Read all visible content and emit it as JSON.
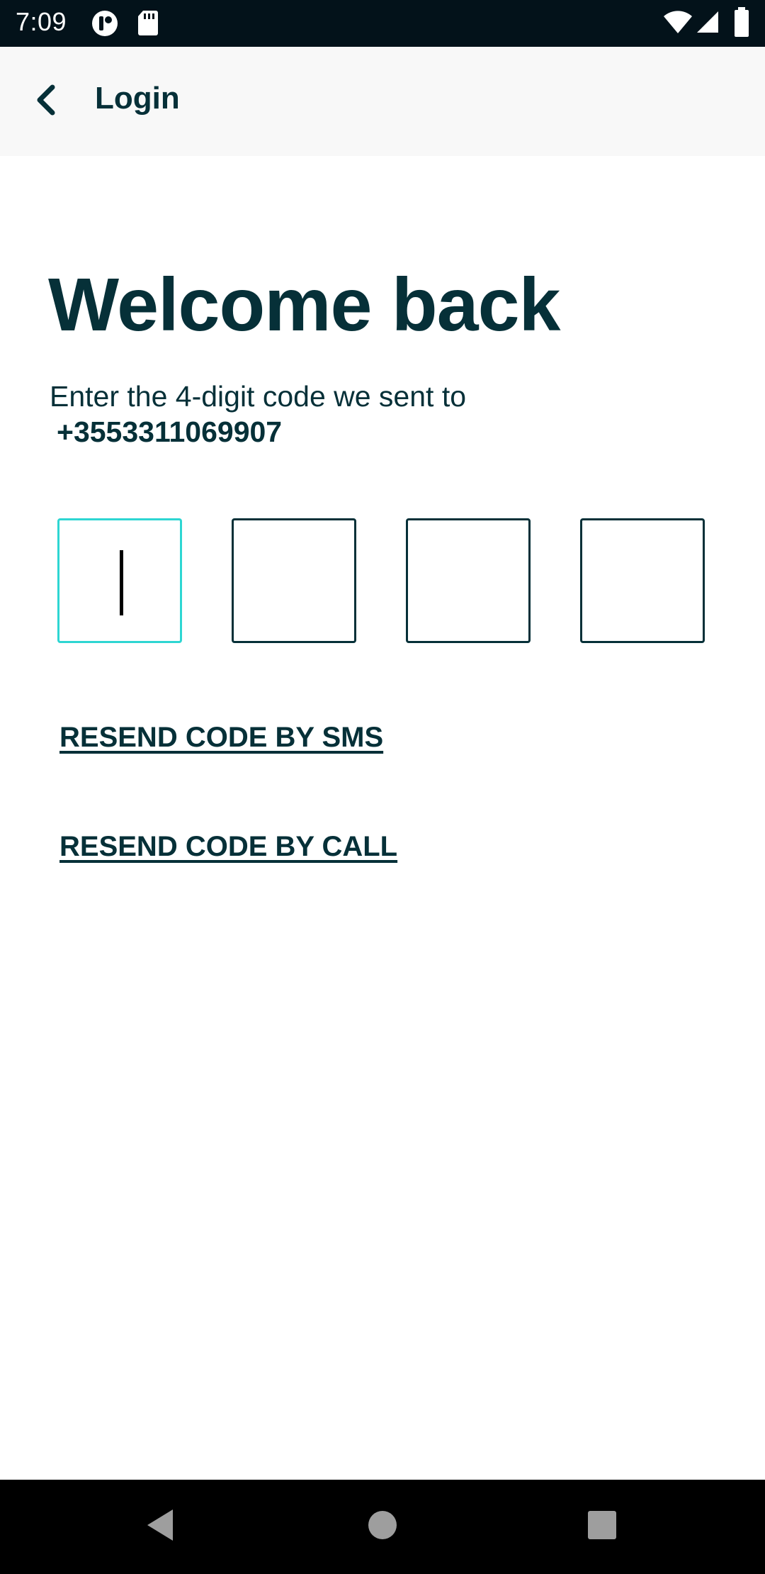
{
  "status_bar": {
    "time": "7:09",
    "icons": [
      "app-notification-icon",
      "sd-card-icon",
      "wifi-icon",
      "cell-signal-icon",
      "battery-icon"
    ]
  },
  "app_bar": {
    "back_icon": "chevron-left-icon",
    "title": "Login"
  },
  "main": {
    "heading": "Welcome back",
    "instruction": "Enter the 4-digit code we sent to",
    "phone_number": "+3553311069907",
    "code_boxes": [
      "",
      "",
      "",
      ""
    ],
    "resend_sms": "RESEND CODE BY SMS",
    "resend_call": "RESEND CODE BY CALL"
  },
  "nav_bar": {
    "icons": [
      "nav-back-icon",
      "nav-home-icon",
      "nav-recents-icon"
    ]
  },
  "colors": {
    "primary": "#063038",
    "accent": "#2ed6d2",
    "status_bar": "#03121a",
    "app_bar": "#f8f8f8"
  }
}
